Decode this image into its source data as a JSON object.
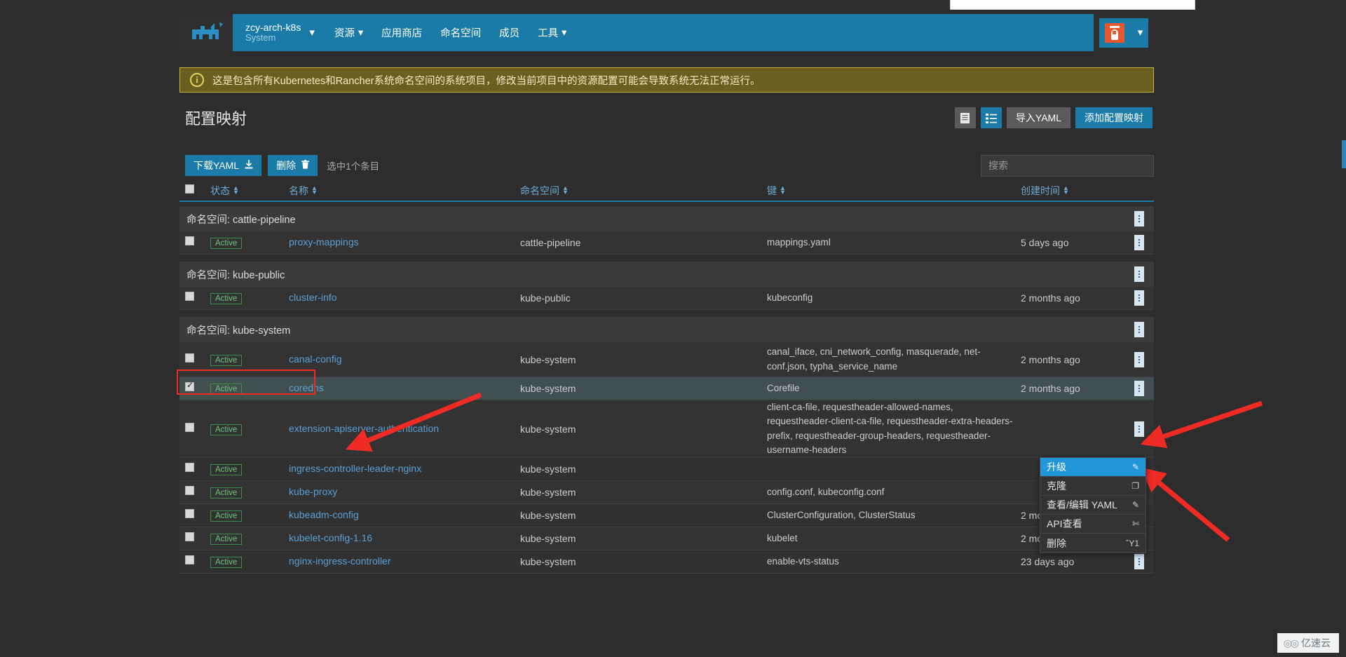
{
  "app": {
    "logo_name": "rancher-cow-logo",
    "cluster": {
      "name": "zcy-arch-k8s",
      "project": "System"
    },
    "nav_items": [
      {
        "label": "资源",
        "has_caret": true
      },
      {
        "label": "应用商店",
        "has_caret": false
      },
      {
        "label": "命名空间",
        "has_caret": false
      },
      {
        "label": "成员",
        "has_caret": false
      },
      {
        "label": "工具",
        "has_caret": true
      }
    ]
  },
  "banner": {
    "text": "这是包含所有Kubernetes和Rancher系统命名空间的系统项目，修改当前项目中的资源配置可能会导致系统无法正常运行。",
    "icon": "info-circle-icon"
  },
  "page": {
    "title": "配置映射",
    "header_buttons": {
      "detail_view_icon": "document-icon",
      "group_view_icon": "list-group-icon",
      "import_yaml": "导入YAML",
      "add_configmap": "添加配置映射"
    }
  },
  "toolbar": {
    "download_yaml": "下载YAML",
    "download_icon": "download-icon",
    "delete": "删除",
    "delete_icon": "trash-icon",
    "selected_text": "选中1个条目"
  },
  "search": {
    "placeholder": "搜索",
    "value": ""
  },
  "table": {
    "columns": [
      {
        "key": "state",
        "label": "状态"
      },
      {
        "key": "name",
        "label": "名称"
      },
      {
        "key": "namespace",
        "label": "命名空间"
      },
      {
        "key": "keys",
        "label": "键"
      },
      {
        "key": "created",
        "label": "创建时间"
      }
    ],
    "group_prefix": "命名空间:",
    "groups": [
      {
        "namespace": "cattle-pipeline",
        "header": "命名空间: cattle-pipeline",
        "rows": [
          {
            "checked": false,
            "state": "Active",
            "name": "proxy-mappings",
            "namespace": "cattle-pipeline",
            "keys": "mappings.yaml",
            "created": "5 days ago",
            "height": "normal",
            "selected": false
          }
        ]
      },
      {
        "namespace": "kube-public",
        "header": "命名空间: kube-public",
        "rows": [
          {
            "checked": false,
            "state": "Active",
            "name": "cluster-info",
            "namespace": "kube-public",
            "keys": "kubeconfig",
            "created": "2 months ago",
            "height": "normal",
            "selected": false
          }
        ]
      },
      {
        "namespace": "kube-system",
        "header": "命名空间: kube-system",
        "annotated": true,
        "rows": [
          {
            "checked": false,
            "state": "Active",
            "name": "canal-config",
            "namespace": "kube-system",
            "keys": "canal_iface, cni_network_config, masquerade, net-conf.json, typha_service_name",
            "created": "2 months ago",
            "height": "tall",
            "selected": false
          },
          {
            "checked": true,
            "state": "Active",
            "name": "coredns",
            "namespace": "kube-system",
            "keys": "Corefile",
            "created": "2 months ago",
            "height": "normal",
            "selected": true
          },
          {
            "checked": false,
            "state": "Active",
            "name": "extension-apiserver-authentication",
            "namespace": "kube-system",
            "keys": "client-ca-file, requestheader-allowed-names, requestheader-client-ca-file, requestheader-extra-headers-prefix, requestheader-group-headers, requestheader-username-headers",
            "created": "",
            "height": "xtall",
            "selected": false
          },
          {
            "checked": false,
            "state": "Active",
            "name": "ingress-controller-leader-nginx",
            "namespace": "kube-system",
            "keys": "",
            "created": "",
            "height": "normal",
            "selected": false
          },
          {
            "checked": false,
            "state": "Active",
            "name": "kube-proxy",
            "namespace": "kube-system",
            "keys": "config.conf, kubeconfig.conf",
            "created": "",
            "height": "normal",
            "selected": false
          },
          {
            "checked": false,
            "state": "Active",
            "name": "kubeadm-config",
            "namespace": "kube-system",
            "keys": "ClusterConfiguration, ClusterStatus",
            "created": "2 months ago",
            "height": "normal",
            "selected": false
          },
          {
            "checked": false,
            "state": "Active",
            "name": "kubelet-config-1.16",
            "namespace": "kube-system",
            "keys": "kubelet",
            "created": "2 months ago",
            "height": "normal",
            "selected": false
          },
          {
            "checked": false,
            "state": "Active",
            "name": "nginx-ingress-controller",
            "namespace": "kube-system",
            "keys": "enable-vts-status",
            "created": "23 days ago",
            "height": "normal",
            "selected": false
          }
        ]
      }
    ]
  },
  "context_menu": {
    "items": [
      {
        "label": "升级",
        "icon": "pencil-icon",
        "glyph": "✎",
        "highlighted": true
      },
      {
        "label": "克隆",
        "icon": "copy-icon",
        "glyph": "❐",
        "highlighted": false
      },
      {
        "label": "查看/编辑 YAML",
        "icon": "pencil-icon",
        "glyph": "✎",
        "highlighted": false
      },
      {
        "label": "API查看",
        "icon": "api-icon",
        "glyph": "✄",
        "highlighted": false
      },
      {
        "label": "删除",
        "icon": "trash-icon",
        "glyph": "Ὕ1",
        "highlighted": false
      }
    ]
  },
  "watermark": {
    "text": "亿速云",
    "glyph": "◎◎"
  },
  "colors": {
    "accent_blue": "#1b7ba8",
    "highlight_blue": "#2196d8",
    "link_blue": "#5b9fd4",
    "active_green": "#6bc47d",
    "banner_yellow": "#c8b23a",
    "annotation_red": "#ee2b24",
    "selected_row": "#41504f"
  }
}
